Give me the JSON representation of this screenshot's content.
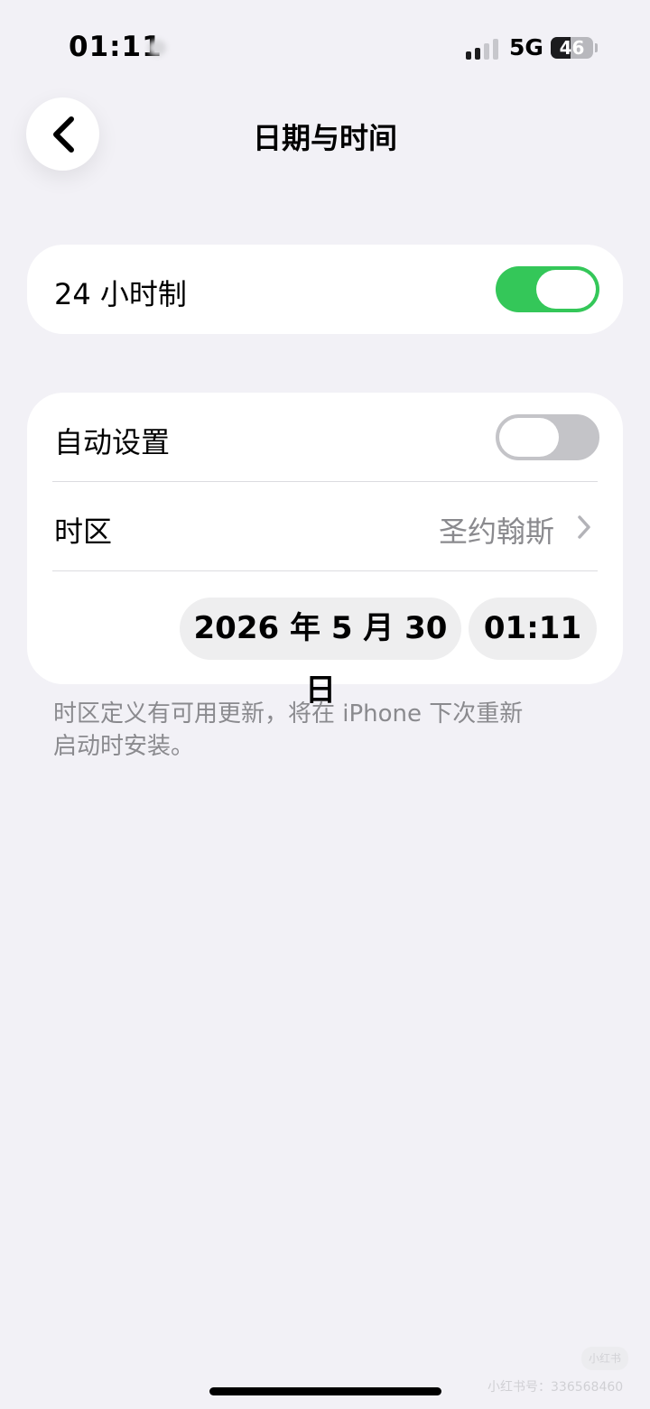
{
  "status_bar": {
    "time": "01:11",
    "network": "5G",
    "battery_level": "46"
  },
  "nav": {
    "title": "日期与时间",
    "back_icon": "chevron-left-icon"
  },
  "settings": {
    "hour_24": {
      "label": "24 小时制",
      "enabled": true
    },
    "auto_set": {
      "label": "自动设置",
      "enabled": false
    },
    "timezone": {
      "label": "时区",
      "value": "圣约翰斯"
    },
    "date": "2026 年 5 月 30 日",
    "time": "01:11"
  },
  "footnote": {
    "line1": "时区定义有可用更新，将在 iPhone 下次重新",
    "line2": "启动时安装。"
  },
  "watermark": {
    "logo": "小红书",
    "text": "小红书号：336568460"
  },
  "colors": {
    "background": "#f2f1f6",
    "toggle_on": "#34c759",
    "toggle_off": "#c4c4c8",
    "secondary_text": "#8a8a8e"
  }
}
